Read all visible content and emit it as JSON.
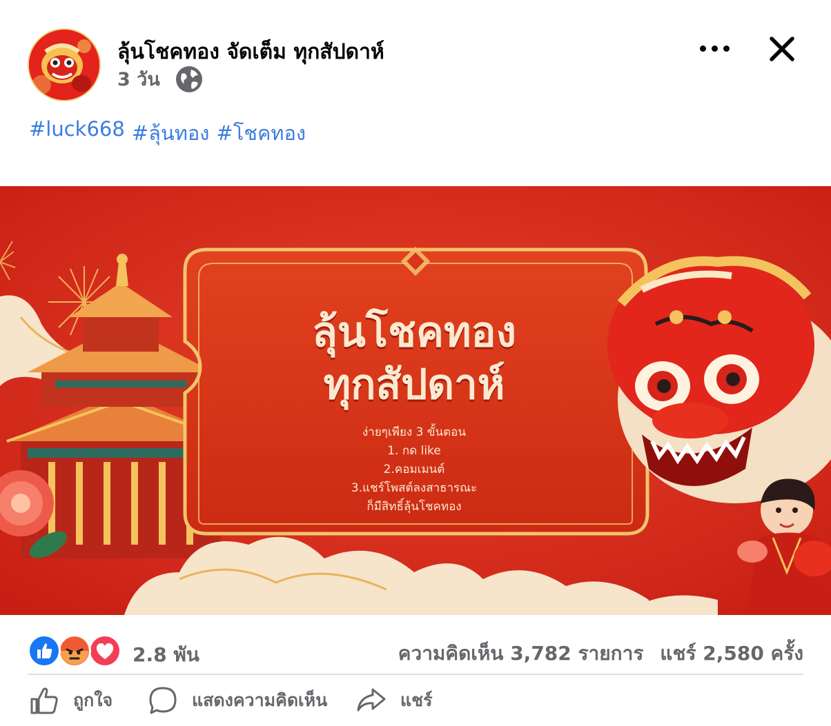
{
  "post": {
    "page_name": "ลุ้นโชคทอง จัดเต็ม ทุกสัปดาห์",
    "timestamp": "3 วัน",
    "privacy_icon": "globe-icon",
    "hashtags": [
      "#luck668",
      "#ลุ้นทอง",
      "#โชคทอง"
    ]
  },
  "banner": {
    "title_line1": "ลุ้นโชคทอง",
    "title_line2": "ทุกสัปดาห์",
    "steps": [
      "ง่ายๆเพียง 3 ขั้นตอน",
      "1. กด like",
      "2.คอมเมนต์",
      "3.แชร์โพสต์ลงสาธารณะ",
      "ก็มีสิทธิ์ลุ้นโชคทอง"
    ]
  },
  "stats": {
    "reaction_icons": [
      "like-icon",
      "angry-icon",
      "love-icon"
    ],
    "reaction_count": "2.8 พัน",
    "comments": "ความคิดเห็น 3,782 รายการ",
    "shares": "แชร์ 2,580 ครั้ง"
  },
  "actions": {
    "like_label": "ถูกใจ",
    "comment_label": "แสดงความคิดเห็น",
    "share_label": "แชร์"
  },
  "colors": {
    "hashtag": "#3b7de0",
    "banner_red": "#d82a1a",
    "gold": "#e7b45a",
    "text_secondary": "#65676b",
    "like_blue": "#1877f2",
    "love_red": "#f33e58",
    "angry_orange": "#f7714c"
  }
}
